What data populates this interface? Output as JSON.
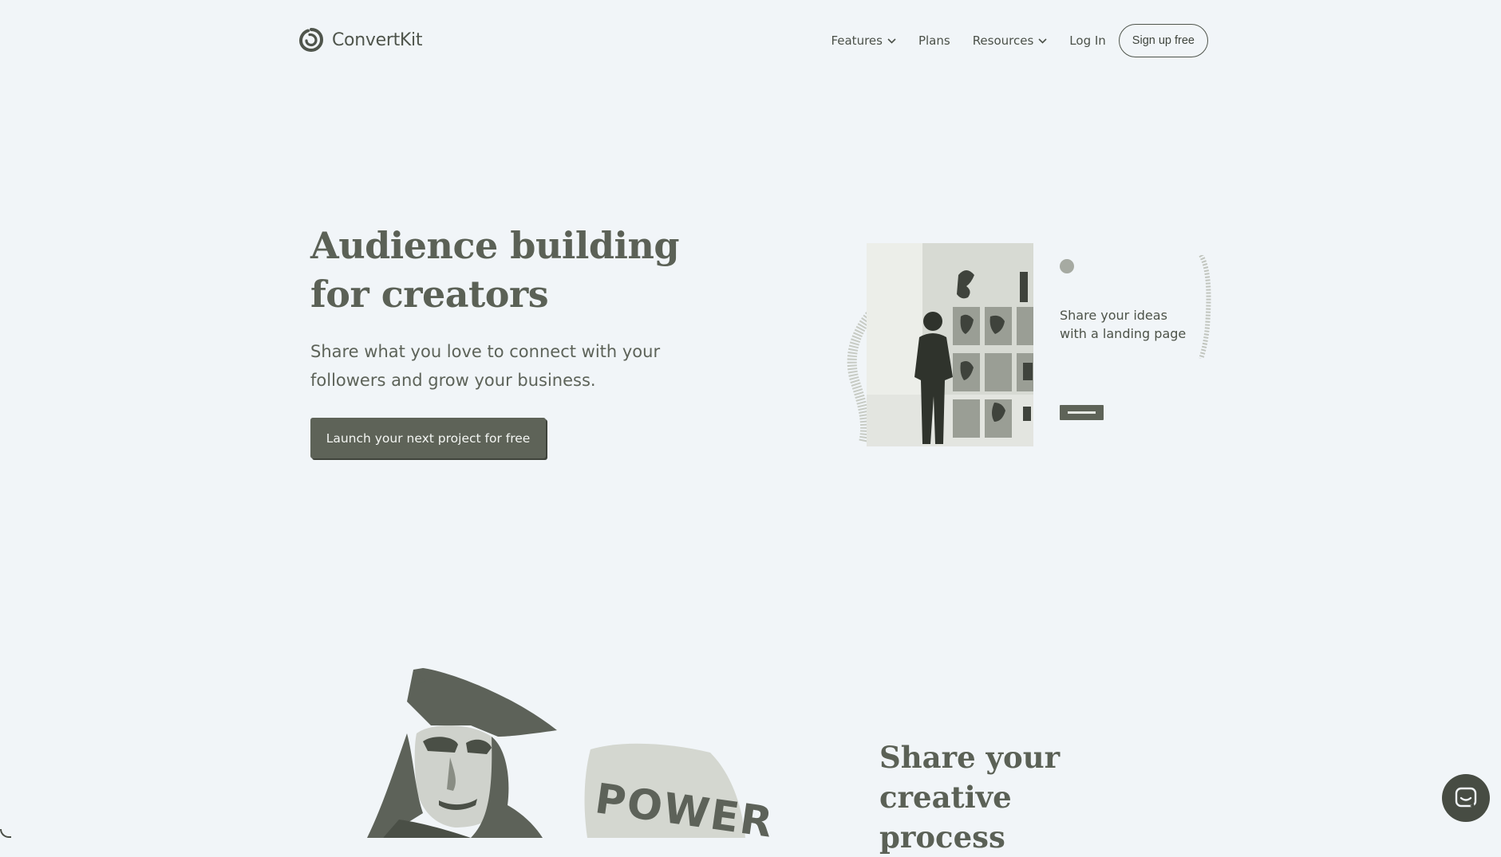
{
  "brand": {
    "name": "ConvertKit",
    "logo_icon": "convertkit-ring-icon"
  },
  "nav": {
    "features": "Features",
    "plans": "Plans",
    "resources": "Resources",
    "login": "Log In",
    "signup": "Sign up free"
  },
  "hero": {
    "title_line1": "Audience building",
    "title_line2": "for creators",
    "subtitle": "Share what you love to connect with your followers and grow your business.",
    "cta": "Launch your next project for free"
  },
  "preview_card": {
    "caption_line1": "Share your ideas",
    "caption_line2": "with a landing page"
  },
  "section2": {
    "title_line1": "Share your creative",
    "title_line2": "process",
    "sign_text": "POWER"
  },
  "chat": {
    "icon": "chat-bubble-icon"
  },
  "colors": {
    "background": "#f1f5f8",
    "text": "#5b6156",
    "button": "#5e6358"
  }
}
